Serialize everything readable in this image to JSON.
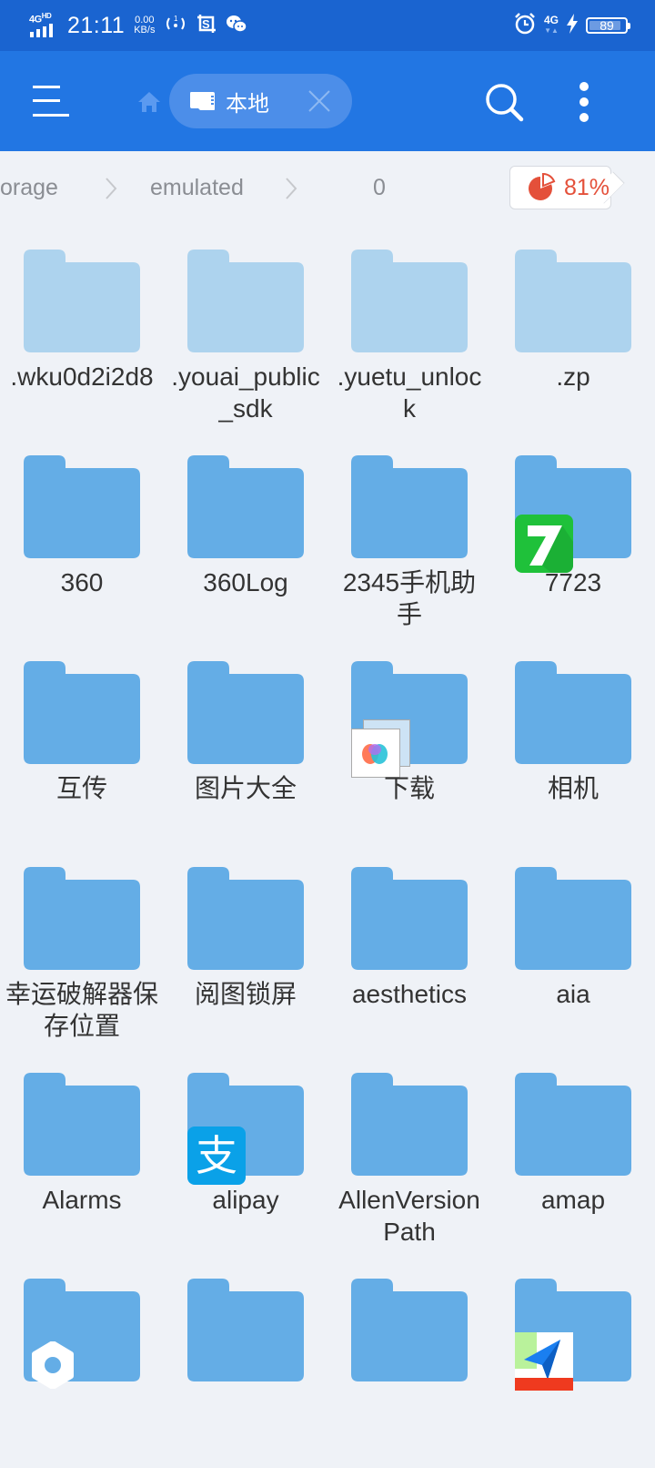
{
  "status_bar": {
    "network_label": "4G",
    "network_hd": "HD",
    "time": "21:11",
    "speed_value": "0.00",
    "speed_unit": "KB/s",
    "icons": [
      "hotspot-icon",
      "screenshot-s-icon",
      "wechat-icon",
      "alarm-icon",
      "4g-data-icon",
      "charging-icon",
      "battery-icon"
    ],
    "data_network": "4G",
    "battery_level": "89",
    "battery_fraction": 0.89
  },
  "toolbar": {
    "menu_icon": "hamburger-menu-icon",
    "home_icon": "home-icon",
    "tab": {
      "icon": "sd-card-icon",
      "label": "本地",
      "close_icon": "close-icon"
    },
    "search_icon": "search-icon",
    "more_icon": "more-vertical-icon"
  },
  "breadcrumb": {
    "items": [
      "orage",
      "emulated",
      "0"
    ],
    "separator_icon": "chevron-right-icon"
  },
  "storage": {
    "icon": "pie-chart-icon",
    "percent_label": "81%",
    "used_fraction": 0.81,
    "color": "#e4503a"
  },
  "colors": {
    "status_bar": "#1a64d0",
    "toolbar": "#2276e3",
    "folder": "#64ade6",
    "folder_hidden": "#add3ee",
    "background": "#eff2f7"
  },
  "folders": [
    {
      "name": ".wku0d2i2d8",
      "hidden": true
    },
    {
      "name": ".youai_public_sdk",
      "hidden": true
    },
    {
      "name": ".yuetu_unlock",
      "hidden": true
    },
    {
      "name": ".zp",
      "hidden": true
    },
    {
      "name": "360"
    },
    {
      "name": "360Log"
    },
    {
      "name": "2345手机助手"
    },
    {
      "name": "7723",
      "app_icon": "7723-app-icon"
    },
    {
      "name": "互传"
    },
    {
      "name": "图片大全"
    },
    {
      "name": "下载",
      "app_icon": "file-thumbnail-icon"
    },
    {
      "name": "相机"
    },
    {
      "name": "幸运破解器保存位置"
    },
    {
      "name": "阅图锁屏"
    },
    {
      "name": "aesthetics"
    },
    {
      "name": "aia"
    },
    {
      "name": "Alarms"
    },
    {
      "name": "alipay",
      "app_icon": "alipay-app-icon",
      "app_glyph": "支"
    },
    {
      "name": "AllenVersionPath"
    },
    {
      "name": "amap"
    },
    {
      "name": "",
      "app_icon": "settings-gear-icon"
    },
    {
      "name": ""
    },
    {
      "name": ""
    },
    {
      "name": "",
      "app_icon": "amap-app-icon"
    }
  ]
}
